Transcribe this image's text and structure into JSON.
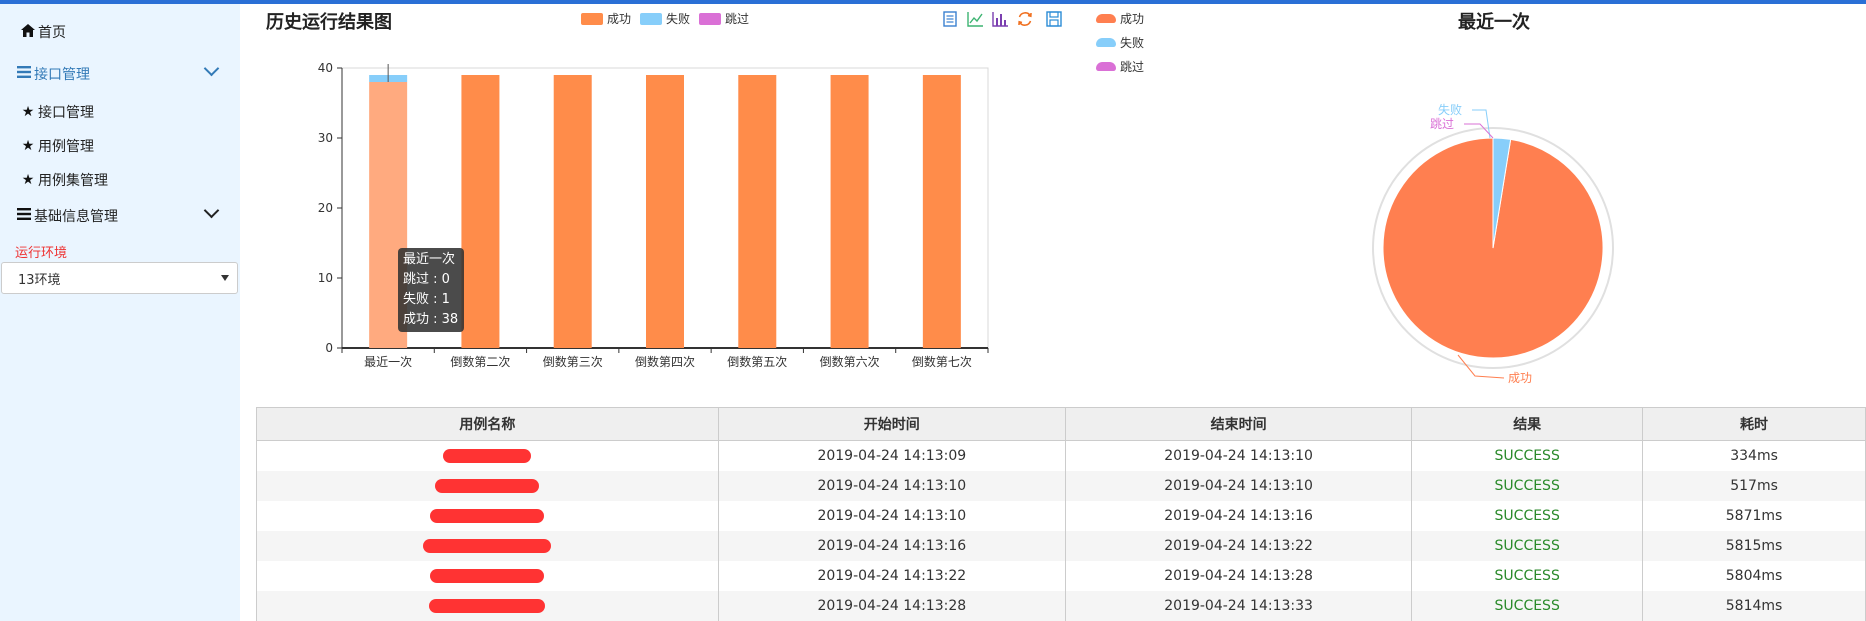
{
  "sidebar": {
    "items": [
      {
        "label": "首页",
        "icon": "home-icon"
      },
      {
        "label": "接口管理",
        "icon": "list-icon"
      },
      {
        "label": "接口管理",
        "icon": "star-icon"
      },
      {
        "label": "用例管理",
        "icon": "star-icon"
      },
      {
        "label": "用例集管理",
        "icon": "star-icon"
      },
      {
        "label": "基础信息管理",
        "icon": "list-icon"
      }
    ],
    "env_label": "运行环境",
    "env_value": "13环境"
  },
  "bar_chart_title": "历史运行结果图",
  "pie_chart_title": "最近一次",
  "tooltip": {
    "title": "最近一次",
    "lines": [
      "跳过 : 0",
      "失败 : 1",
      "成功 : 38"
    ]
  },
  "colors": {
    "success": "#ff8c4a",
    "fail": "#87cefa",
    "skip": "#da70d6",
    "success_pass": "#2a8a2a",
    "accent": "#337ab7"
  },
  "toolbar_icons": [
    "data-view-icon",
    "line-chart-icon",
    "bar-chart-icon",
    "refresh-icon",
    "save-icon"
  ],
  "chart_data": [
    {
      "type": "bar",
      "title": "历史运行结果图",
      "categories": [
        "最近一次",
        "倒数第二次",
        "倒数第三次",
        "倒数第四次",
        "倒数第五次",
        "倒数第六次",
        "倒数第七次"
      ],
      "series": [
        {
          "name": "成功",
          "values": [
            38,
            39,
            39,
            39,
            39,
            39,
            39
          ]
        },
        {
          "name": "失败",
          "values": [
            1,
            0,
            0,
            0,
            0,
            0,
            0
          ]
        },
        {
          "name": "跳过",
          "values": [
            0,
            0,
            0,
            0,
            0,
            0,
            0
          ]
        }
      ],
      "stacked": true,
      "ylim": [
        0,
        40
      ],
      "yticks": [
        0,
        10,
        20,
        30,
        40
      ],
      "legend": "top-center"
    },
    {
      "type": "pie",
      "title": "最近一次",
      "labels": [
        "成功",
        "失败",
        "跳过"
      ],
      "values": [
        38,
        1,
        0
      ],
      "legend": "top-left"
    }
  ],
  "table": {
    "headers": [
      "用例名称",
      "开始时间",
      "结束时间",
      "结果",
      "耗时"
    ],
    "rows": [
      {
        "start": "2019-04-24 14:13:09",
        "end": "2019-04-24 14:13:10",
        "result": "SUCCESS",
        "duration": "334ms"
      },
      {
        "start": "2019-04-24 14:13:10",
        "end": "2019-04-24 14:13:10",
        "result": "SUCCESS",
        "duration": "517ms"
      },
      {
        "start": "2019-04-24 14:13:10",
        "end": "2019-04-24 14:13:16",
        "result": "SUCCESS",
        "duration": "5871ms"
      },
      {
        "start": "2019-04-24 14:13:16",
        "end": "2019-04-24 14:13:22",
        "result": "SUCCESS",
        "duration": "5815ms"
      },
      {
        "start": "2019-04-24 14:13:22",
        "end": "2019-04-24 14:13:28",
        "result": "SUCCESS",
        "duration": "5804ms"
      },
      {
        "start": "2019-04-24 14:13:28",
        "end": "2019-04-24 14:13:33",
        "result": "SUCCESS",
        "duration": "5814ms"
      }
    ]
  }
}
